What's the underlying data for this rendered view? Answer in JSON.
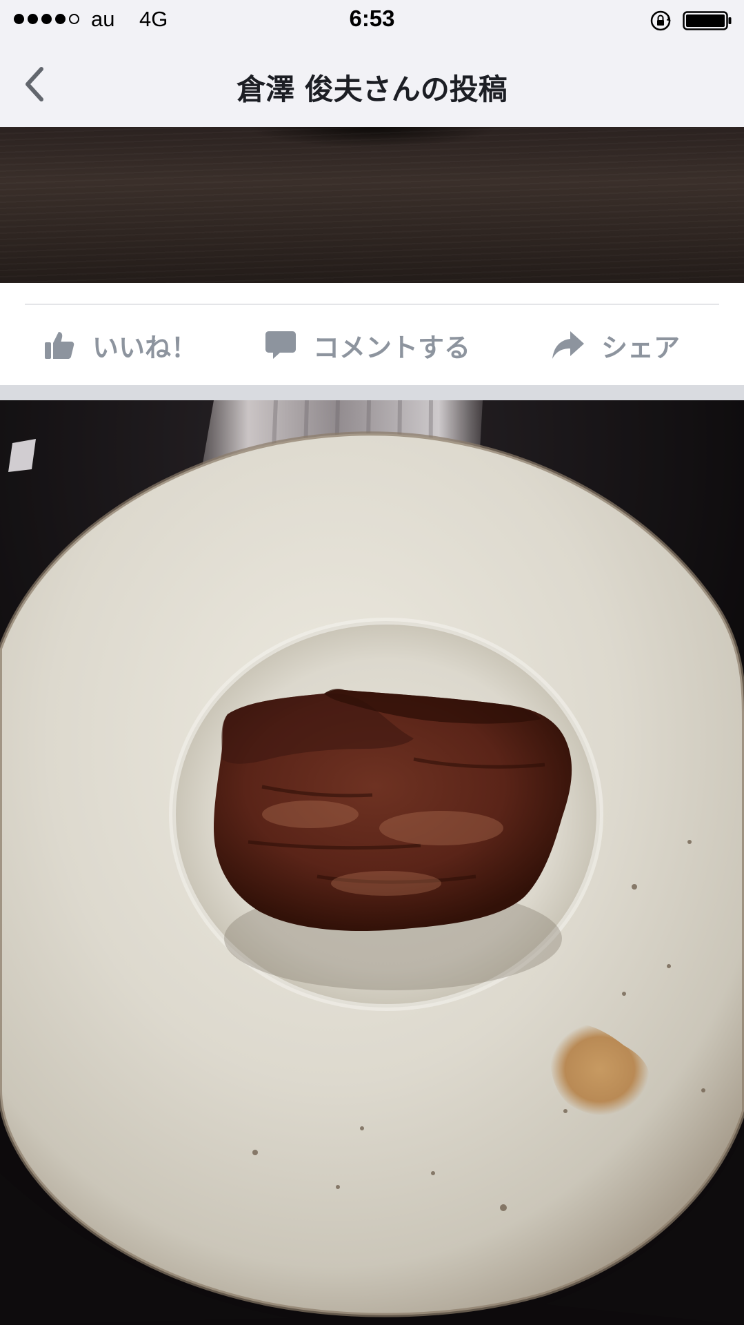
{
  "status_bar": {
    "carrier": "au",
    "network": "4G",
    "time": "6:53",
    "signal_bars_filled": 4,
    "signal_bars_total": 5,
    "battery_level": 1.0
  },
  "nav": {
    "back_icon": "chevron-left-icon",
    "title": "倉澤 俊夫さんの投稿"
  },
  "actions": {
    "like_icon": "thumbs-up-icon",
    "like_label": "いいね！",
    "comment_icon": "speech-bubble-icon",
    "comment_label": "コメントする",
    "share_icon": "share-arrow-icon",
    "share_label": "シェア"
  },
  "colors": {
    "bar_background": "#f2f2f6",
    "action_text": "#8d949e",
    "title_text": "#1c1e24",
    "separator": "#d9dbe0"
  }
}
